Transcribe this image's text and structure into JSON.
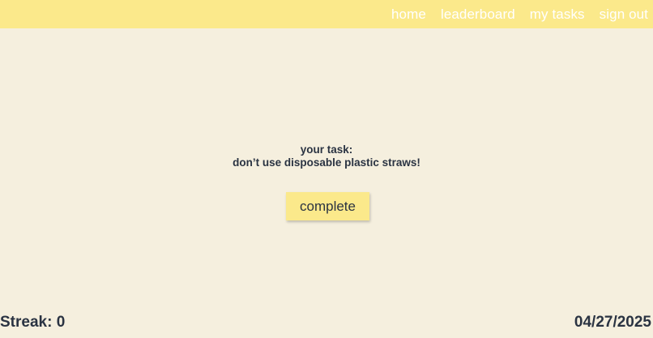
{
  "nav": {
    "home": "home",
    "leaderboard": "leaderboard",
    "my_tasks": "my tasks",
    "sign_out": "sign out"
  },
  "task": {
    "heading": "your task:",
    "description": "don’t use disposable plastic straws!"
  },
  "complete_button": "complete",
  "footer": {
    "streak": "Streak: 0",
    "date": "04/27/2025"
  },
  "colors": {
    "background": "#f5efde",
    "accent": "#fbe98b",
    "text": "#2a3342",
    "nav_text": "#ffffff"
  }
}
